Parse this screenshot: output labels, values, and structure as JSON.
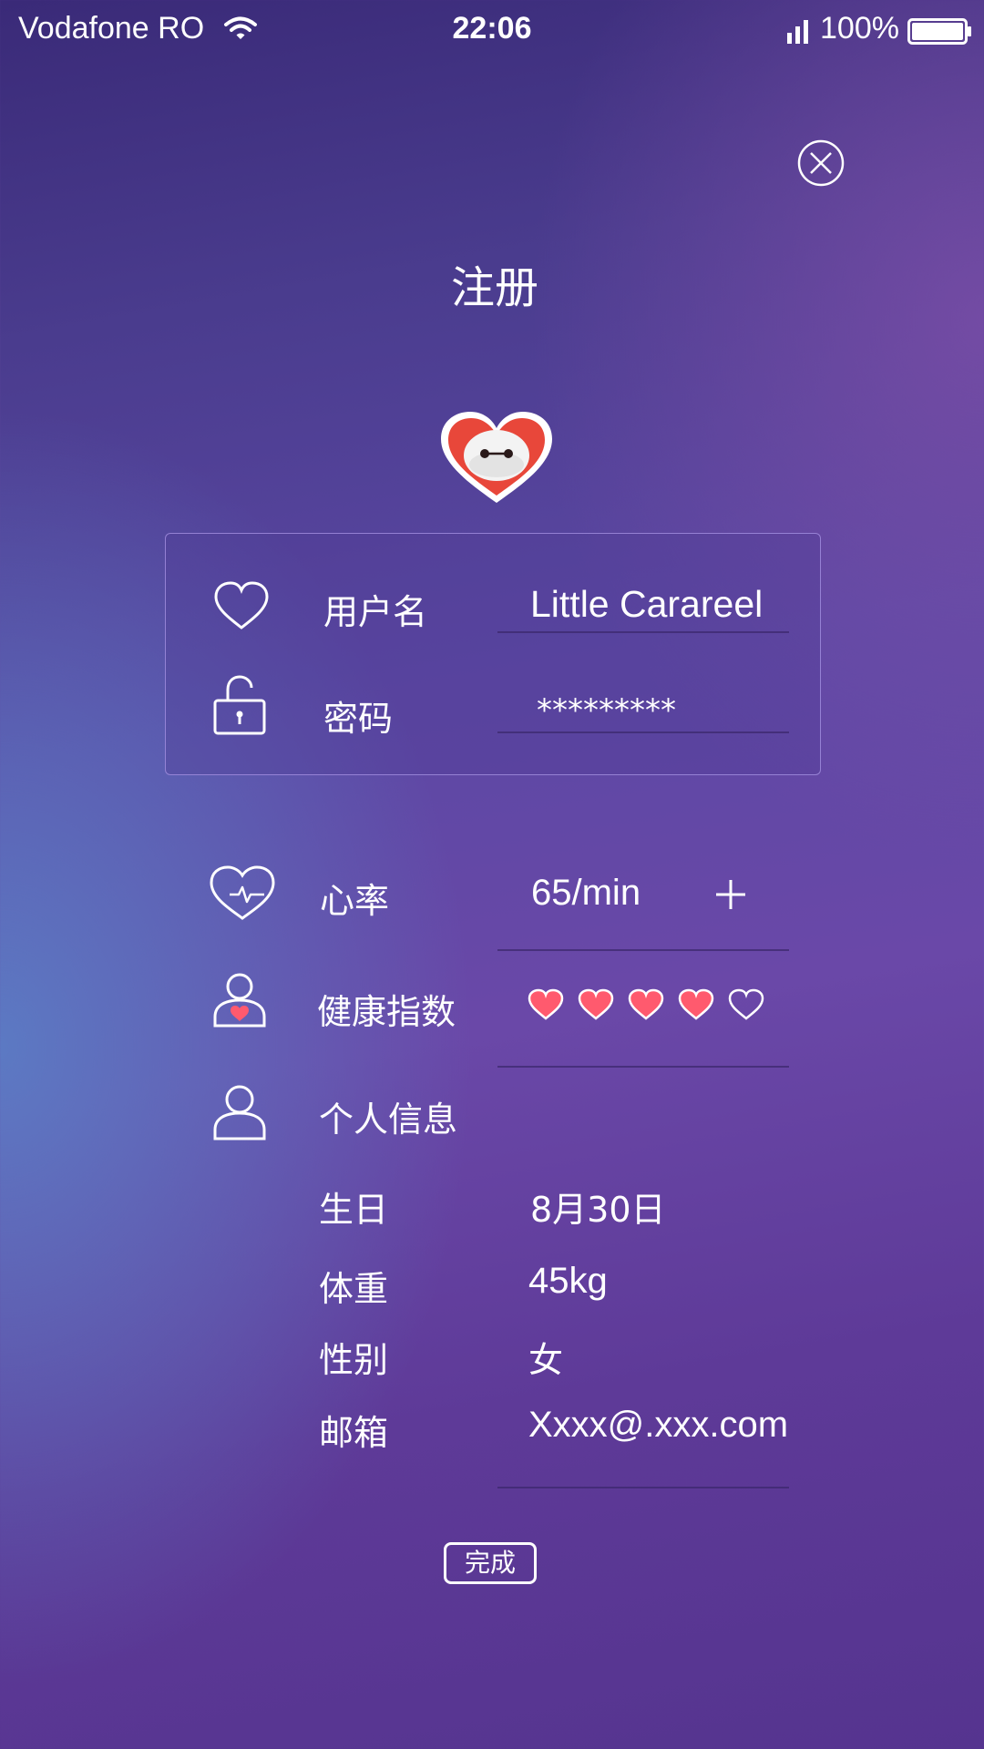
{
  "status_bar": {
    "carrier": "Vodafone RO",
    "time": "22:06",
    "battery": "100%"
  },
  "title": "注册",
  "account": {
    "username_label": "用户名",
    "username_value": "Little Carareel",
    "password_label": "密码",
    "password_value": "*********"
  },
  "health": {
    "heart_rate_label": "心率",
    "heart_rate_value": "65/min",
    "health_index_label": "健康指数",
    "health_index_rating": 4,
    "health_index_max": 5
  },
  "personal": {
    "section_label": "个人信息",
    "fields": [
      {
        "label": "生日",
        "value": "8月30日"
      },
      {
        "label": "体重",
        "value": "45kg"
      },
      {
        "label": "性别",
        "value": "女"
      },
      {
        "label": "邮箱",
        "value": "Xxxx@.xxx.com"
      }
    ]
  },
  "done_label": "完成",
  "icons": {
    "close": "close-circle-icon",
    "avatar": "baymax-heart-avatar",
    "username": "heart-outline-icon",
    "password": "unlock-icon",
    "heart_rate": "heartbeat-icon",
    "health_index": "person-heart-icon",
    "personal": "person-icon",
    "add": "plus-icon"
  },
  "colors": {
    "accent_heart": "#ff5a6e",
    "avatar_heart": "#e8473a"
  }
}
